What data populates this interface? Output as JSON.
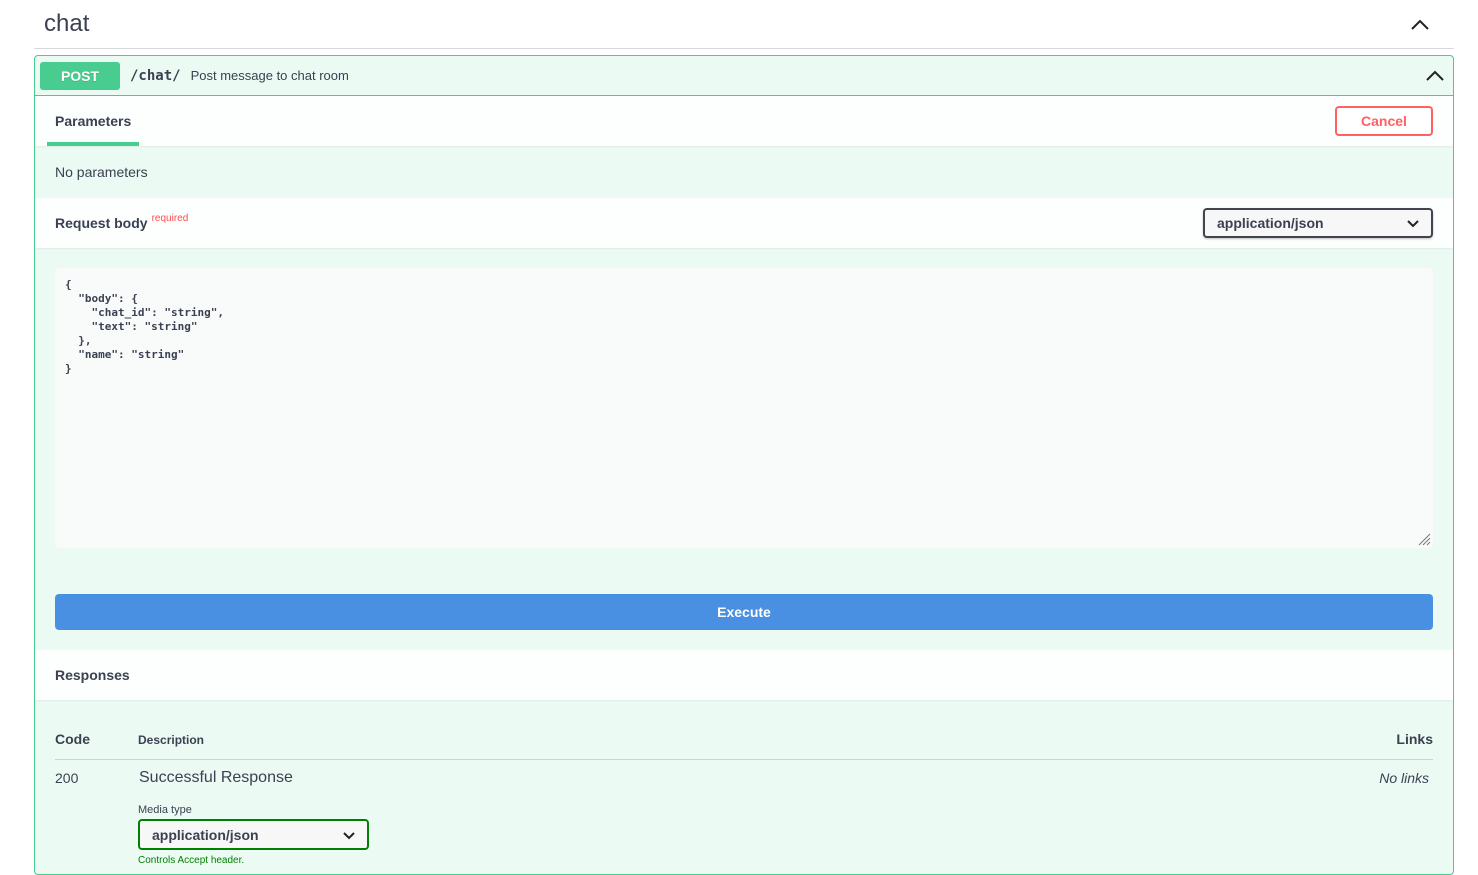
{
  "tag": {
    "title": "chat",
    "toggle_icon": "chevron-up-icon"
  },
  "operation": {
    "method": "POST",
    "path": "/chat/",
    "summary": "Post message to chat room",
    "toggle_icon": "chevron-up-icon",
    "method_color": "#49cc90"
  },
  "parameters": {
    "tab_label": "Parameters",
    "cancel_label": "Cancel",
    "empty_text": "No parameters"
  },
  "request_body": {
    "title": "Request body",
    "required_label": "required",
    "content_type": "application/json",
    "example": "{\n  \"body\": {\n    \"chat_id\": \"string\",\n    \"text\": \"string\"\n  },\n  \"name\": \"string\"\n}"
  },
  "execute": {
    "label": "Execute",
    "color": "#4990e2"
  },
  "responses": {
    "title": "Responses",
    "columns": {
      "code": "Code",
      "description": "Description",
      "links": "Links"
    },
    "rows": [
      {
        "code": "200",
        "description": "Successful Response",
        "links": "No links",
        "media_type_label": "Media type",
        "media_type": "application/json",
        "accept_hint": "Controls Accept header."
      }
    ]
  }
}
